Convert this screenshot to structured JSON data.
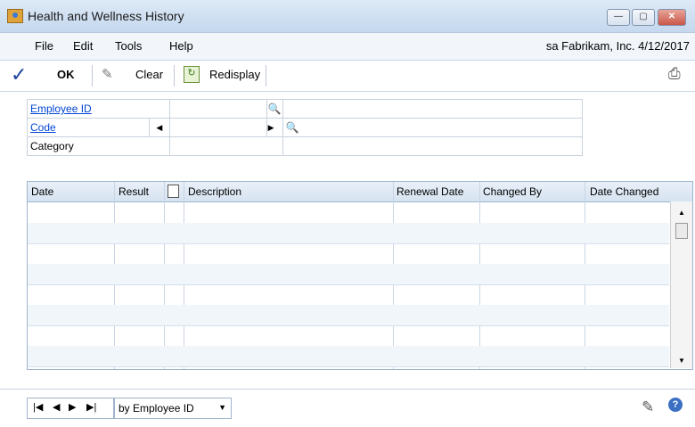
{
  "window": {
    "title": "Health and Wellness History"
  },
  "menubar": {
    "items": [
      "File",
      "Edit",
      "Tools",
      "Help"
    ],
    "company_info": "sa  Fabrikam, Inc. 4/12/2017"
  },
  "toolbar": {
    "ok": "OK",
    "clear": "Clear",
    "redisplay": "Redisplay"
  },
  "form": {
    "employee_id_label": "Employee ID",
    "code_label": "Code",
    "category_label": "Category"
  },
  "grid": {
    "columns": [
      "Date",
      "Result",
      "Description",
      "Renewal Date",
      "Changed By",
      "Date Changed"
    ],
    "row_count": 8
  },
  "status": {
    "sort_by": "by Employee ID"
  }
}
